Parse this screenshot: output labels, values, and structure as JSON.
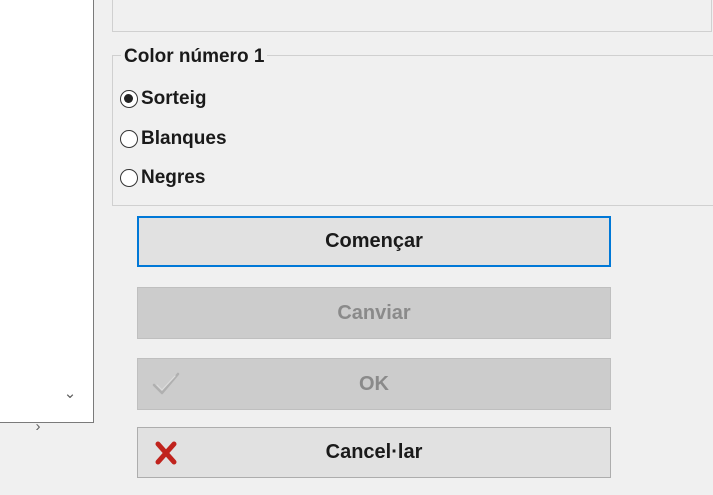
{
  "left_panel": {
    "scroll_down_glyph": "⌄",
    "scroll_right_glyph": "›"
  },
  "color_group": {
    "title": "Color número 1",
    "options": [
      {
        "label": "Sorteig",
        "checked": true
      },
      {
        "label": "Blanques",
        "checked": false
      },
      {
        "label": "Negres",
        "checked": false
      }
    ]
  },
  "buttons": {
    "start_label": "Començar",
    "change_label": "Canviar",
    "ok_label": "OK",
    "cancel_label": "Cancel·lar"
  },
  "icons": {
    "ok_icon": "checkmark-icon",
    "cancel_icon": "red-x-icon"
  },
  "colors": {
    "focus_border": "#0078d7",
    "cancel_x": "#c0231d",
    "disabled_text": "#8a8a8a"
  }
}
